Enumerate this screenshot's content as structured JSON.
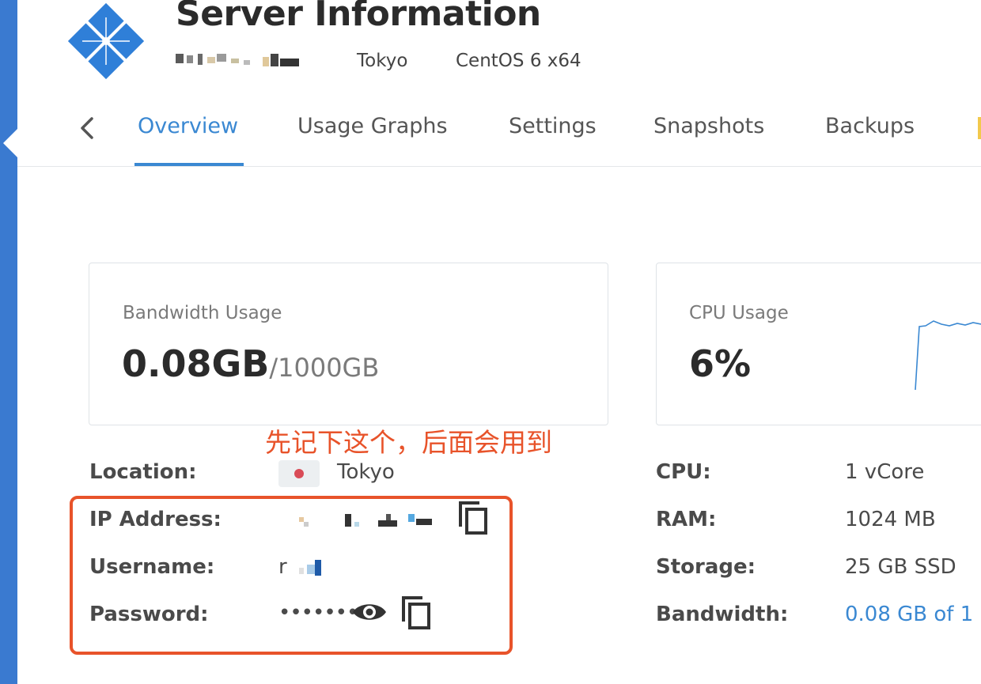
{
  "page": {
    "title": "Server Information",
    "location": "Tokyo",
    "os": "CentOS 6 x64"
  },
  "tabs": [
    {
      "label": "Overview",
      "active": true
    },
    {
      "label": "Usage Graphs",
      "active": false
    },
    {
      "label": "Settings",
      "active": false
    },
    {
      "label": "Snapshots",
      "active": false
    },
    {
      "label": "Backups",
      "active": false
    }
  ],
  "bandwidth_card": {
    "label": "Bandwidth Usage",
    "value": "0.08GB",
    "total": "/1000GB"
  },
  "cpu_card": {
    "label": "CPU Usage",
    "value": "6%"
  },
  "annotation": "先记下这个，后面会用到",
  "details_left": {
    "location_label": "Location:",
    "location_value": "Tokyo",
    "ip_label": "IP Address:",
    "username_label": "Username:",
    "username_visible": "r",
    "password_label": "Password:",
    "password_value": "•••••••"
  },
  "details_right": {
    "cpu_label": "CPU:",
    "cpu_value": "1 vCore",
    "ram_label": "RAM:",
    "ram_value": "1024 MB",
    "storage_label": "Storage:",
    "storage_value": "25 GB SSD",
    "bandwidth_label": "Bandwidth:",
    "bandwidth_value": "0.08 GB of 1"
  },
  "icons": {
    "logo": "vultr-logo-icon",
    "back": "chevron-left-icon",
    "copy": "copy-icon",
    "show_password": "eye-icon"
  },
  "colors": {
    "accent": "#3a88d2",
    "annotation": "#e8532a",
    "rail": "#3a7ad0"
  }
}
